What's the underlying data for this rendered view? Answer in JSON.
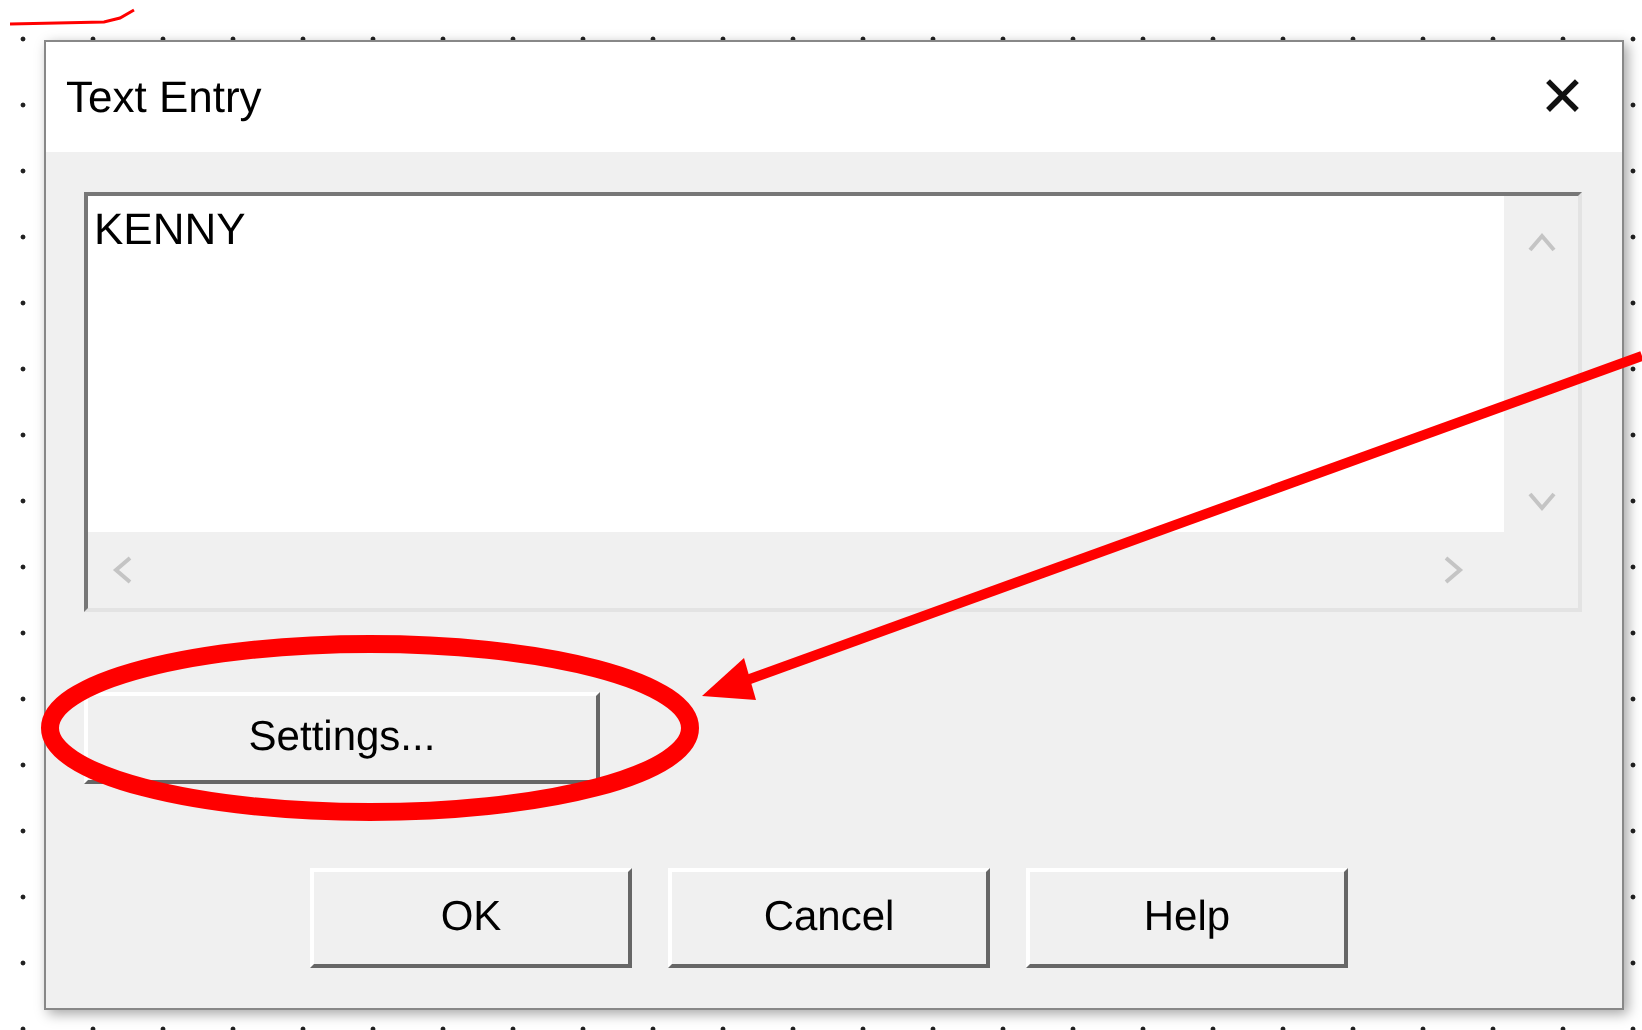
{
  "window": {
    "title": "Text Entry",
    "close": "✕"
  },
  "text_entry": {
    "value": "KENNY"
  },
  "settings_button": "Settings...",
  "buttons": [
    "OK",
    "Cancel",
    "Help"
  ]
}
